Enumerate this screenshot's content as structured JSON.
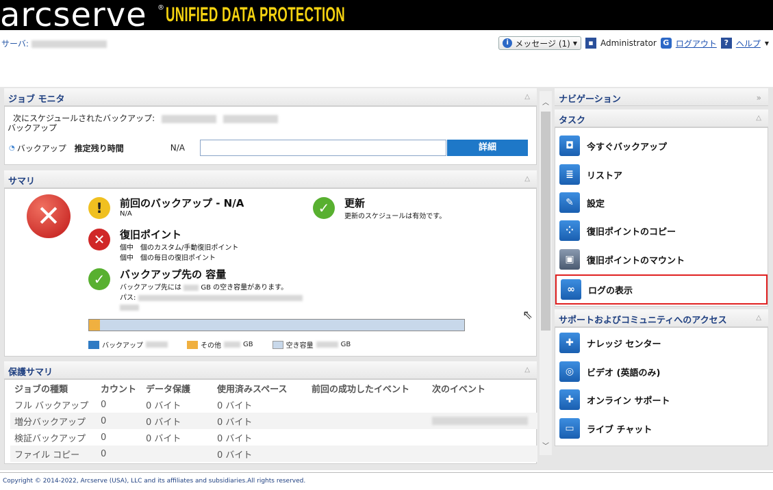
{
  "brand": {
    "logo": "arcserve",
    "reg": "®",
    "subtitle": "UNIFIED DATA PROTECTION"
  },
  "server": {
    "label": "サーバ:"
  },
  "topnav": {
    "messages": "メッセージ (1)",
    "user": "Administrator",
    "logout": "ログアウト",
    "help": "ヘルプ"
  },
  "job_monitor": {
    "title": "ジョブ モニタ",
    "next_scheduled": "次にスケジュールされたバックアップ:",
    "backup_word": "バックアップ",
    "row_label": "バックアップ",
    "eta_label": "推定残り時間",
    "eta_value": "N/A",
    "detail_button": "詳細"
  },
  "summary": {
    "title": "サマリ",
    "last_backup_title": "前回のバックアップ - N/A",
    "last_backup_sub": "N/A",
    "update_title": "更新",
    "update_sub": "更新のスケジュールは有効です。",
    "recovery_title": "復旧ポイント",
    "recovery_line1": "個中　個のカスタム/手動復旧ポイント",
    "recovery_line2": "個中　個の毎日の復旧ポイント",
    "dest_title": "バックアップ先の 容量",
    "dest_line1_a": "バックアップ先には",
    "dest_line1_b": "GB の空き容量があります。",
    "dest_path": "パス:",
    "legend_backup": "バックアップ",
    "legend_other": "その他",
    "legend_other_unit": "GB",
    "legend_free": "空き容量",
    "legend_free_unit": "GB",
    "usage_other_fraction": 0.03,
    "colors": {
      "backup": "#2f7bc4",
      "other": "#f0b040",
      "free": "#c8d8ea"
    }
  },
  "protection_summary": {
    "title": "保護サマリ",
    "columns": [
      "ジョブの種類",
      "カウント",
      "データ保護",
      "使用済みスペース",
      "前回の成功したイベント",
      "次のイベント"
    ],
    "rows": [
      [
        "フル バックアップ",
        "0",
        "0 バイト",
        "0 バイト",
        "",
        ""
      ],
      [
        "増分バックアップ",
        "0",
        "0 バイト",
        "0 バイト",
        "",
        ""
      ],
      [
        "検証バックアップ",
        "0",
        "0 バイト",
        "0 バイト",
        "",
        ""
      ],
      [
        "ファイル コピー",
        "0",
        "",
        "0 バイト",
        "",
        ""
      ]
    ]
  },
  "navigation": {
    "title": "ナビゲーション",
    "tasks_title": "タスク",
    "tasks": [
      {
        "label": "今すぐバックアップ",
        "icon": "backup-now-icon"
      },
      {
        "label": "リストア",
        "icon": "restore-icon"
      },
      {
        "label": "設定",
        "icon": "settings-wrench-icon"
      },
      {
        "label": "復旧ポイントのコピー",
        "icon": "copy-recovery-point-icon"
      },
      {
        "label": "復旧ポイントのマウント",
        "icon": "mount-recovery-point-icon"
      },
      {
        "label": "ログの表示",
        "icon": "view-logs-icon"
      }
    ],
    "support_title": "サポートおよびコミュニティへのアクセス",
    "support": [
      {
        "label": "ナレッジ センター",
        "icon": "knowledge-center-icon"
      },
      {
        "label": "ビデオ (英語のみ)",
        "icon": "video-icon"
      },
      {
        "label": "オンライン サポート",
        "icon": "online-support-icon"
      },
      {
        "label": "ライブ チャット",
        "icon": "live-chat-icon"
      }
    ]
  },
  "footer": {
    "copyright": "Copyright © 2014-2022, Arcserve (USA), LLC and its affiliates and subsidiaries.All rights reserved."
  }
}
